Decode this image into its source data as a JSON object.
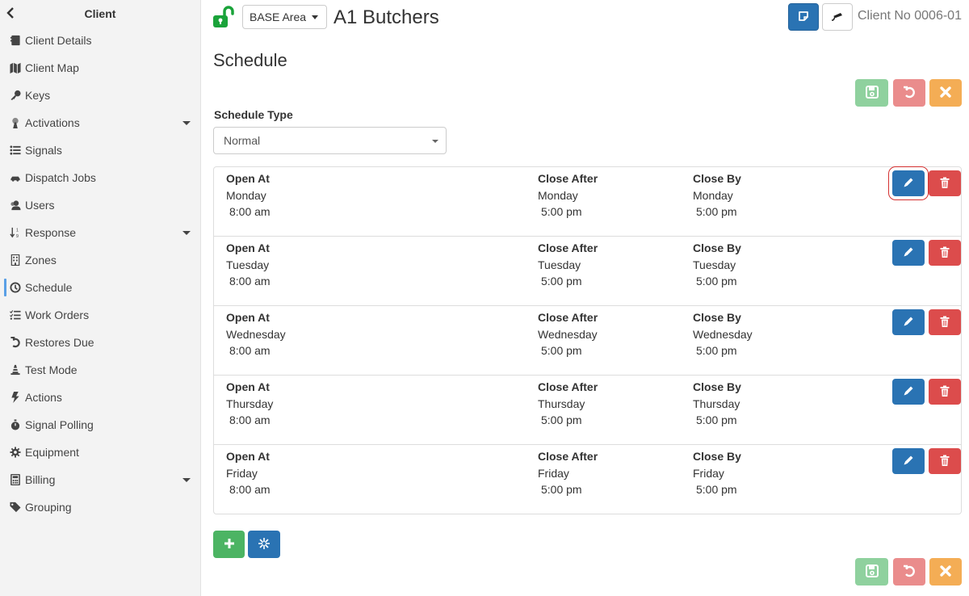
{
  "sidebar": {
    "title": "Client",
    "back_icon": "chevron-left-icon",
    "items": [
      {
        "label": "Client Details",
        "icon": "address-card-icon",
        "active": false,
        "expandable": false
      },
      {
        "label": "Client Map",
        "icon": "map-icon",
        "active": false,
        "expandable": false
      },
      {
        "label": "Keys",
        "icon": "key-icon",
        "active": false,
        "expandable": false
      },
      {
        "label": "Activations",
        "icon": "antenna-icon",
        "active": false,
        "expandable": true
      },
      {
        "label": "Signals",
        "icon": "list-icon",
        "active": false,
        "expandable": false
      },
      {
        "label": "Dispatch Jobs",
        "icon": "car-icon",
        "active": false,
        "expandable": false
      },
      {
        "label": "Users",
        "icon": "users-icon",
        "active": false,
        "expandable": false
      },
      {
        "label": "Response",
        "icon": "sort-numeric-icon",
        "active": false,
        "expandable": true
      },
      {
        "label": "Zones",
        "icon": "building-icon",
        "active": false,
        "expandable": false
      },
      {
        "label": "Schedule",
        "icon": "clock-icon",
        "active": true,
        "expandable": false
      },
      {
        "label": "Work Orders",
        "icon": "checklist-icon",
        "active": false,
        "expandable": false
      },
      {
        "label": "Restores Due",
        "icon": "undo-icon",
        "active": false,
        "expandable": false
      },
      {
        "label": "Test Mode",
        "icon": "traffic-cone-icon",
        "active": false,
        "expandable": false
      },
      {
        "label": "Actions",
        "icon": "bolt-icon",
        "active": false,
        "expandable": false
      },
      {
        "label": "Signal Polling",
        "icon": "stopwatch-icon",
        "active": false,
        "expandable": false
      },
      {
        "label": "Equipment",
        "icon": "cog-icon",
        "active": false,
        "expandable": false
      },
      {
        "label": "Billing",
        "icon": "calculator-icon",
        "active": false,
        "expandable": true
      },
      {
        "label": "Grouping",
        "icon": "tag-icon",
        "active": false,
        "expandable": false
      }
    ]
  },
  "header": {
    "lock_icon": "unlock-icon",
    "lock_color": "#1aa33a",
    "area_label": "BASE Area",
    "client_name": "A1 Butchers",
    "client_no": "Client No 0006-01",
    "note_icon": "sticky-note-icon",
    "camera_icon": "cctv-camera-icon"
  },
  "page": {
    "title": "Schedule",
    "schedule_type_label": "Schedule Type",
    "schedule_type_value": "Normal",
    "columns": [
      "Open At",
      "Close After",
      "Close By"
    ],
    "rows": [
      {
        "open_day": "Monday",
        "open_time": "8:00 am",
        "close_after_day": "Monday",
        "close_after_time": "5:00 pm",
        "close_by_day": "Monday",
        "close_by_time": "5:00 pm"
      },
      {
        "open_day": "Tuesday",
        "open_time": "8:00 am",
        "close_after_day": "Tuesday",
        "close_after_time": "5:00 pm",
        "close_by_day": "Tuesday",
        "close_by_time": "5:00 pm"
      },
      {
        "open_day": "Wednesday",
        "open_time": "8:00 am",
        "close_after_day": "Wednesday",
        "close_after_time": "5:00 pm",
        "close_by_day": "Wednesday",
        "close_by_time": "5:00 pm"
      },
      {
        "open_day": "Thursday",
        "open_time": "8:00 am",
        "close_after_day": "Thursday",
        "close_after_time": "5:00 pm",
        "close_by_day": "Thursday",
        "close_by_time": "5:00 pm"
      },
      {
        "open_day": "Friday",
        "open_time": "8:00 am",
        "close_after_day": "Friday",
        "close_after_time": "5:00 pm",
        "close_by_day": "Friday",
        "close_by_time": "5:00 pm"
      }
    ]
  },
  "colors": {
    "primary": "#2a73b3",
    "success": "#4cb463",
    "danger": "#dc4c4c",
    "save_disabled": "#8fd19e",
    "undo_disabled": "#ea8c8c",
    "cancel": "#f4ad55",
    "active_indicator": "#5aa0e6"
  }
}
